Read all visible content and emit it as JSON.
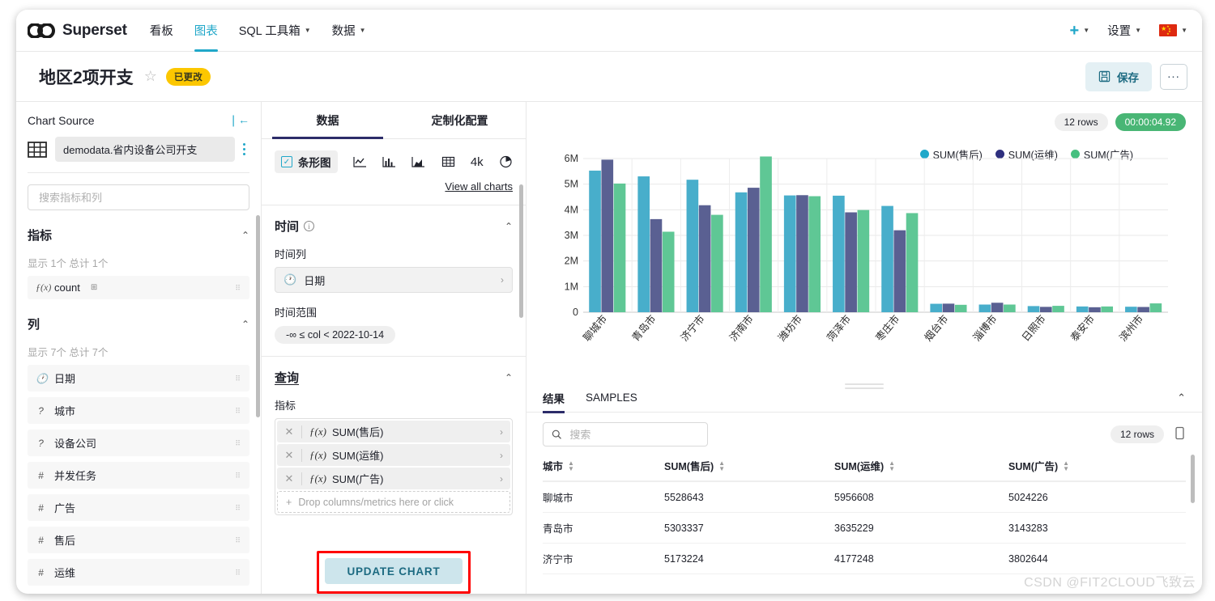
{
  "navbar": {
    "brand": "Superset",
    "items": [
      {
        "label": "看板",
        "active": false,
        "has_caret": false
      },
      {
        "label": "图表",
        "active": true,
        "has_caret": false
      },
      {
        "label": "SQL 工具箱",
        "active": false,
        "has_caret": true
      },
      {
        "label": "数据",
        "active": false,
        "has_caret": true
      }
    ],
    "plus_label": "+",
    "settings_label": "设置",
    "language": "中文"
  },
  "chart_header": {
    "title": "地区2项开支",
    "badge": "已更改",
    "save_label": "保存",
    "more_label": "..."
  },
  "left_panel": {
    "title": "Chart Source",
    "dataset": "demodata.省内设备公司开支",
    "search_placeholder": "搜索指标和列",
    "metrics_section": {
      "title": "指标",
      "count_text": "显示 1个 总计 1个",
      "items": [
        {
          "icon": "fx",
          "label": "count"
        }
      ]
    },
    "columns_section": {
      "title": "列",
      "count_text": "显示 7个 总计 7个",
      "items": [
        {
          "icon": "clock",
          "label": "日期"
        },
        {
          "icon": "question",
          "label": "城市"
        },
        {
          "icon": "question",
          "label": "设备公司"
        },
        {
          "icon": "hash",
          "label": "并发任务"
        },
        {
          "icon": "hash",
          "label": "广告"
        },
        {
          "icon": "hash",
          "label": "售后"
        },
        {
          "icon": "hash",
          "label": "运维"
        }
      ]
    }
  },
  "mid_panel": {
    "tabs": [
      {
        "label": "数据",
        "active": true
      },
      {
        "label": "定制化配置",
        "active": false
      }
    ],
    "viz_selected": "条形图",
    "viz_icons": [
      "line-chart-icon",
      "bar-chart-icon",
      "area-chart-icon",
      "table-icon",
      "big-number-icon",
      "pie-chart-icon"
    ],
    "viz_big_number_label": "4k",
    "view_all_charts": "View all charts",
    "time_section": {
      "title": "时间",
      "time_column_label": "时间列",
      "time_column_value": "日期",
      "time_range_label": "时间范围",
      "time_range_value": "-∞ ≤ col < 2022-10-14"
    },
    "query_section": {
      "title": "查询",
      "metrics_label": "指标",
      "metrics": [
        "SUM(售后)",
        "SUM(运维)",
        "SUM(广告)"
      ],
      "drop_zone": "Drop columns/metrics here or click"
    },
    "update_button": "UPDATE CHART"
  },
  "chart_panel": {
    "rows_pill": "12 rows",
    "time_pill": "00:00:04.92"
  },
  "results_panel": {
    "tabs": [
      {
        "label": "结果",
        "active": true
      },
      {
        "label": "SAMPLES",
        "active": false
      }
    ],
    "search_placeholder": "搜索",
    "rows_pill": "12 rows",
    "columns": [
      "城市",
      "SUM(售后)",
      "SUM(运维)",
      "SUM(广告)"
    ],
    "rows": [
      [
        "聊城市",
        "5528643",
        "5956608",
        "5024226"
      ],
      [
        "青岛市",
        "5303337",
        "3635229",
        "3143283"
      ],
      [
        "济宁市",
        "5173224",
        "4177248",
        "3802644"
      ]
    ]
  },
  "watermark": "CSDN @FIT2CLOUD飞致云",
  "chart_data": {
    "type": "bar",
    "title": "",
    "xlabel": "",
    "ylabel": "",
    "ylim": [
      0,
      6000000
    ],
    "yticks": [
      0,
      1000000,
      2000000,
      3000000,
      4000000,
      5000000,
      6000000
    ],
    "ytick_labels": [
      "0",
      "1M",
      "2M",
      "3M",
      "4M",
      "5M",
      "6M"
    ],
    "grid": true,
    "legend_position": "top-right",
    "categories": [
      "聊城市",
      "青岛市",
      "济宁市",
      "济南市",
      "潍坊市",
      "菏泽市",
      "枣庄市",
      "烟台市",
      "淄博市",
      "日照市",
      "泰安市",
      "滨州市"
    ],
    "series": [
      {
        "name": "SUM(售后)",
        "color": "#1fa8c9",
        "values": [
          5528643,
          5303337,
          5173224,
          4680000,
          4560000,
          4550000,
          4150000,
          330000,
          300000,
          240000,
          225000,
          215000
        ]
      },
      {
        "name": "SUM(运维)",
        "color": "#2e2f7e",
        "values": [
          5956608,
          3635229,
          4177248,
          4860000,
          4570000,
          3900000,
          3200000,
          335000,
          370000,
          210000,
          195000,
          205000
        ]
      },
      {
        "name": "SUM(广告)",
        "color": "#45bf7f",
        "values": [
          5024226,
          3143283,
          3802644,
          6080000,
          4530000,
          3990000,
          3870000,
          290000,
          300000,
          250000,
          225000,
          345000
        ]
      }
    ],
    "bar_colors_rendered": {
      "SUM(售后)": "#48aecb",
      "SUM(运维)": "#5a6092",
      "SUM(广告)": "#5fc795"
    }
  }
}
